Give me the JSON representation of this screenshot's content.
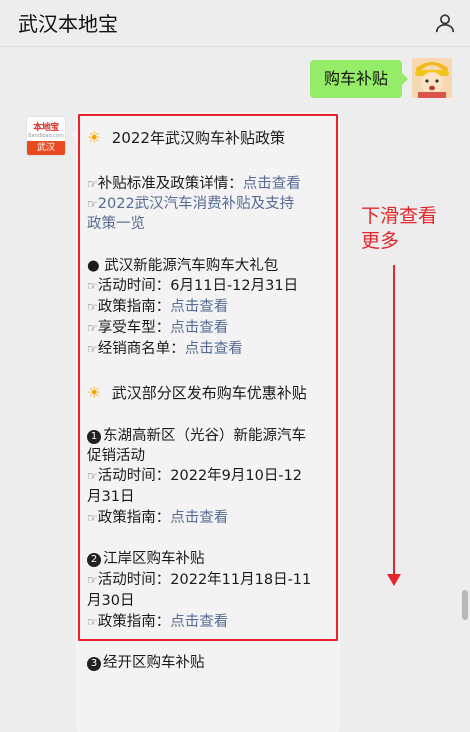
{
  "header": {
    "title": "武汉本地宝"
  },
  "user_message": {
    "text": "购车补贴"
  },
  "bot_avatar": {
    "logo_text": "本地宝",
    "logo_sub": "Bendibao.com",
    "city_tag": "武汉"
  },
  "message": {
    "section1_title": "2022年武汉购车补贴政策",
    "s1_label1": "补贴标准及政策详情：",
    "s1_link1": "点击查看",
    "s1_link2_line1": "2022武汉汽车消费补贴及支持",
    "s1_link2_line2": "政策一览",
    "s1_item_title": "● 武汉新能源汽车购车大礼包",
    "s1_time_label": "活动时间：",
    "s1_time_value": "6月11日-12月31日",
    "s1_policy_label": "政策指南：",
    "s1_policy_link": "点击查看",
    "s1_cars_label": "享受车型：",
    "s1_cars_link": "点击查看",
    "s1_dealer_label": "经销商名单：",
    "s1_dealer_link": "点击查看",
    "section2_title": "武汉部分区发布购车优惠补贴",
    "d1_num": "1",
    "d1_title_line1": "东湖高新区（光谷）新能源汽车",
    "d1_title_line2": "促销活动",
    "d1_time_label": "活动时间：",
    "d1_time_value_line1": "2022年9月10日-12",
    "d1_time_value_line2": "月31日",
    "d1_policy_label": "政策指南：",
    "d1_policy_link": "点击查看",
    "d2_num": "2",
    "d2_title": "江岸区购车补贴",
    "d2_time_label": "活动时间：",
    "d2_time_value_line1": "2022年11月18日-11",
    "d2_time_value_line2": "月30日",
    "d2_policy_label": "政策指南：",
    "d2_policy_link": "点击查看",
    "d3_num": "3",
    "d3_title": "经开区购车补贴"
  },
  "annotation": {
    "line1": "下滑查看",
    "line2": "更多"
  },
  "colors": {
    "highlight": "#e3262b",
    "link": "#576b95",
    "user_bubble": "#95ec69"
  },
  "icons": {
    "person": "person-icon",
    "sun": "sun-icon",
    "pointing_hand": "pointing-hand-icon"
  }
}
